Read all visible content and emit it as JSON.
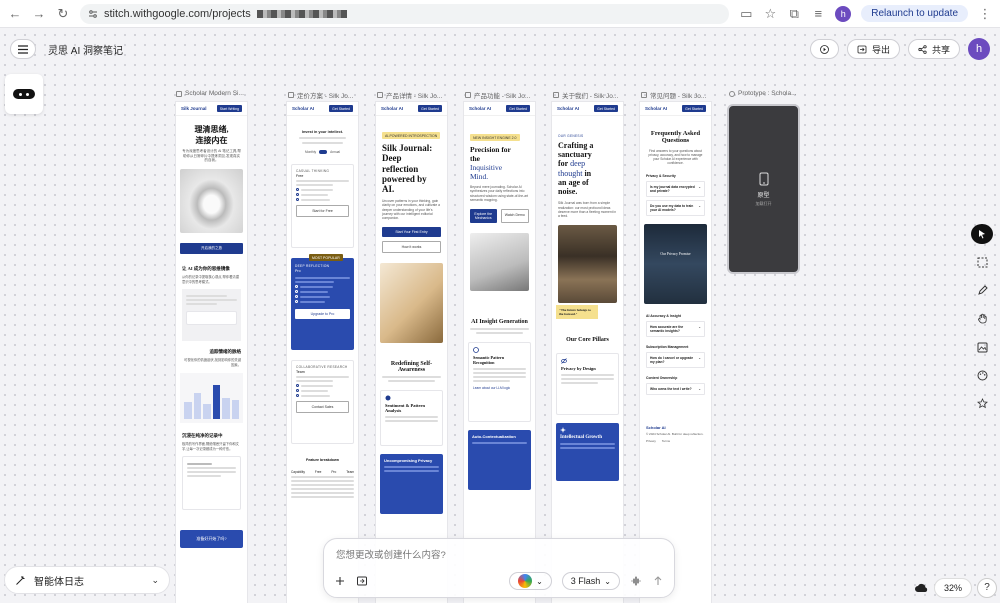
{
  "browser": {
    "url": "stitch.withgoogle.com/projects",
    "profile_initial": "h",
    "relaunch_label": "Relaunch to update"
  },
  "app": {
    "project_title": "灵思 AI 洞察笔记",
    "export_label": "导出",
    "share_label": "共享",
    "avatar_initial": "h"
  },
  "frames": [
    {
      "label": "Scholar Modern Si..."
    },
    {
      "label": "定价方案 - Silk Jo..."
    },
    {
      "label": "产品详情 - Silk Jo..."
    },
    {
      "label": "产品功能 - Silk Jo..."
    },
    {
      "label": "关于我们 - Silk Jo..."
    },
    {
      "label": "常见问题 - Silk Jo..."
    },
    {
      "label": "Prototype : Schola..."
    }
  ],
  "home": {
    "logo": "Silk Journal",
    "cta": "Start Writing",
    "hero_1": "理清思绪,",
    "hero_2": "连接内在",
    "hero_body": "专为深度思考者设计的 AI 笔记工具,帮助你从日常碎片中提炼洞见,发现真实的自我。",
    "btn": "开启我的之旅",
    "sec1_title": "让 AI 成为你的思维镜像",
    "sec1_body": "从你的记录中提取核心观点,帮你看清潜意识中的思考模式。",
    "sec2_title": "追踪情绪的脉络",
    "sec2_body": "可视化你的情绪起伏,找到影响你的关键因素。",
    "sec3_title": "沉浸在纯净的记录中",
    "sec3_body": "极简的写作界面,隔绝喧嚣只留下你和文字,让每一次记录都成为一种疗愈。",
    "bottom_cta": "准备好开始了吗?"
  },
  "pricing": {
    "logo": "Scholar AI",
    "cta": "Get Started",
    "intro": "Invest in your intellect.",
    "toggle_monthly": "Monthly",
    "toggle_annual": "Annual",
    "plan1_name": "CASUAL THINKING",
    "plan1_price": "Free",
    "plan1_btn": "Start for Free",
    "badge": "MOST POPULAR",
    "plan2_name": "DEEP REFLECTION",
    "plan2_price": "Pro",
    "plan2_btn": "Upgrade to Pro",
    "plan3_name": "COLLABORATIVE RESEARCH",
    "plan3_price": "Team",
    "plan3_btn": "Contact Sales",
    "table_title": "Feature breakdown",
    "col_capability": "Capability",
    "col_free": "Free",
    "col_pro": "Pro",
    "col_team": "Team"
  },
  "detail": {
    "logo": "Scholar AI",
    "cta": "Get Started",
    "tag": "AI-POWERED INTROSPECTION",
    "hero_1": "Silk Journal:",
    "hero_2": "Deep",
    "hero_3": "reflection",
    "hero_4": "powered by",
    "hero_5": "AI.",
    "body": "Uncover patterns in your thinking, gain clarity on your emotions, and cultivate a deeper understanding of your life's journey with our intelligent editorial companion.",
    "btn1": "Start Your First Entry",
    "btn2": "How it works",
    "sec_title": "Redefining Self-Awareness",
    "card_title": "Sentiment & Pattern Analysis",
    "privacy_title": "Uncompromising Privacy"
  },
  "features": {
    "logo": "Scholar AI",
    "cta": "Get Started",
    "tag": "NEW INSIGHT ENGINE 2.0",
    "hero_1": "Precision for",
    "hero_2": "the",
    "hero_3": "Inquisitive",
    "hero_4": "Mind.",
    "body": "Beyond mere journaling. Scholar AI synthesizes your daily reflections into structured wisdom using state-of-the-art semantic mapping.",
    "btn1": "Explore the Mechanics",
    "btn2": "Watch Demo",
    "sec_title": "AI Insight Generation",
    "card1_title": "Semantic Pattern Recognition",
    "card1_link": "Learn about our LLM logic",
    "card2_title": "Auto-Contextualization"
  },
  "about": {
    "logo": "Scholar AI",
    "cta": "Get Started",
    "tag": "OUR GENESIS",
    "hero_1": "Crafting a",
    "hero_2": "sanctuary",
    "hero_3": "for",
    "hero_4": "deep",
    "hero_5": "thought",
    "hero_6": "in",
    "hero_7": "an age of",
    "hero_8": "noise.",
    "body": "Silk Journal was born from a simple realization: our most profound ideas deserve more than a fleeting moment in a feed.",
    "quote": "\"The future belongs to the focused.\"",
    "pillars_title": "Our Core Pillars",
    "pillar1": "Privacy by Design",
    "pillar2": "Intellectual Growth"
  },
  "faq": {
    "logo": "Scholar AI",
    "cta": "Get Started",
    "title_1": "Frequently Asked",
    "title_2": "Questions",
    "intro": "Find answers to your questions about privacy, accuracy, and how to manage your Scholar AI experience with confidence.",
    "cat1": "Privacy & Security",
    "q1": "Is my journal data encrypted and private?",
    "q2": "Do you use my data to train your AI models?",
    "promise": "Our Privacy Promise",
    "cat2": "AI Accuracy & Insight",
    "q3": "How accurate are the semantic insights?",
    "cat3": "Subscription Management",
    "q4": "How do I cancel or upgrade my plan?",
    "cat4": "Content Ownership",
    "q5": "Who owns the text I write?",
    "footer_logo": "Scholar AI",
    "footer_copy": "© 2024 Scholar AI. Built for deep reflection.",
    "footer_privacy": "Privacy",
    "footer_terms": "Terms"
  },
  "prototype": {
    "title": "原型",
    "subtitle": "加载打开"
  },
  "bottom": {
    "agent_log": "智能体日志",
    "composer_placeholder": "您想更改或创建什么内容?",
    "model_label": "3 Flash",
    "zoom": "32%",
    "help": "?"
  },
  "colors": {
    "brand_blue": "#1f3b8f",
    "accent_purple": "#6c4bbf",
    "highlight_yellow": "#f5e08e"
  }
}
